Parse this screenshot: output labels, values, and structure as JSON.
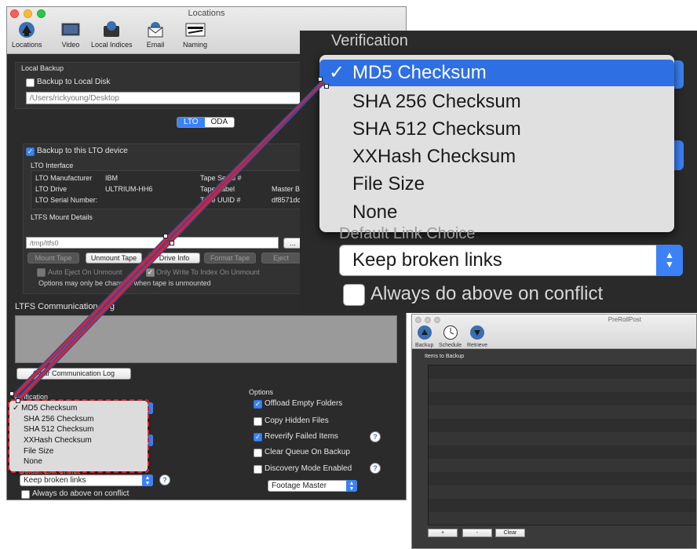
{
  "main_window": {
    "title": "Locations",
    "toolbar": [
      "Locations",
      "Video",
      "Local Indices",
      "Email",
      "Naming"
    ],
    "local_backup": {
      "section": "Local Backup",
      "checkbox": "Backup to Local Disk",
      "path": "/Users/rickyoung/Desktop"
    },
    "segmented": [
      "LTO",
      "ODA"
    ],
    "lto": {
      "checkbox": "Backup to this LTO device",
      "interface": "LTO Interface",
      "manufacturer_label": "LTO Manufacturer",
      "manufacturer": "IBM",
      "drive_label": "LTO Drive",
      "drive": "ULTRIUM-HH6",
      "serial_label": "LTO Serial Number:",
      "tape_serial": "Tape Serial #",
      "tape_label": "Tape Label",
      "master": "Master B",
      "tape_uuid": "Tape UUID #",
      "uuid_value": "df8571dc",
      "mount_details": "LTFS Mount Details",
      "mount_path": "/tmp/ltfs0",
      "browse": "...",
      "buttons": [
        "Mount Tape",
        "Unmount Tape",
        "Drive Info",
        "Format Tape",
        "Eject"
      ],
      "auto_eject": "Auto Eject On Unmount",
      "write_index": "Only Write To Index On Unmount",
      "note": "Options may only be changed when tape is unmounted"
    },
    "log": {
      "title": "LTFS Communication Log",
      "clear": "Clear Communication Log"
    },
    "verification_label": "Verification",
    "verification_options": [
      "MD5 Checksum",
      "SHA 256 Checksum",
      "SHA 512 Checksum",
      "XXHash Checksum",
      "File Size",
      "None"
    ],
    "checkmark": "✓",
    "link_choice_label": "Default Link Choice",
    "link_choice": "Keep broken links",
    "always_conflict": "Always do above on conflict",
    "help": "?",
    "options": {
      "title": "Options",
      "offload": "Offload Empty Folders",
      "hidden": "Copy Hidden Files",
      "reverify": "Reverify Failed Items",
      "clear_queue": "Clear Queue On Backup",
      "discovery": "Discovery Mode Enabled",
      "mode": "Footage Master"
    }
  },
  "zoom": {
    "verification_label": "Verification",
    "options": [
      "MD5 Checksum",
      "SHA 256 Checksum",
      "SHA 512 Checksum",
      "XXHash Checksum",
      "File Size",
      "None"
    ],
    "link_choice_label": "Default Link Choice",
    "link_choice": "Keep broken links",
    "always_conflict": "Always do above on conflict"
  },
  "preroll": {
    "title": "PreRollPost",
    "toolbar": [
      "Backup",
      "Schedule",
      "Retrieve"
    ],
    "list_title": "Items to Backup",
    "buttons": [
      "+",
      "-",
      "Clear"
    ]
  },
  "colors": {
    "accent": "#3b82f6",
    "arrow": "#e0202a",
    "arrow_outline": "#3a4a9a"
  }
}
